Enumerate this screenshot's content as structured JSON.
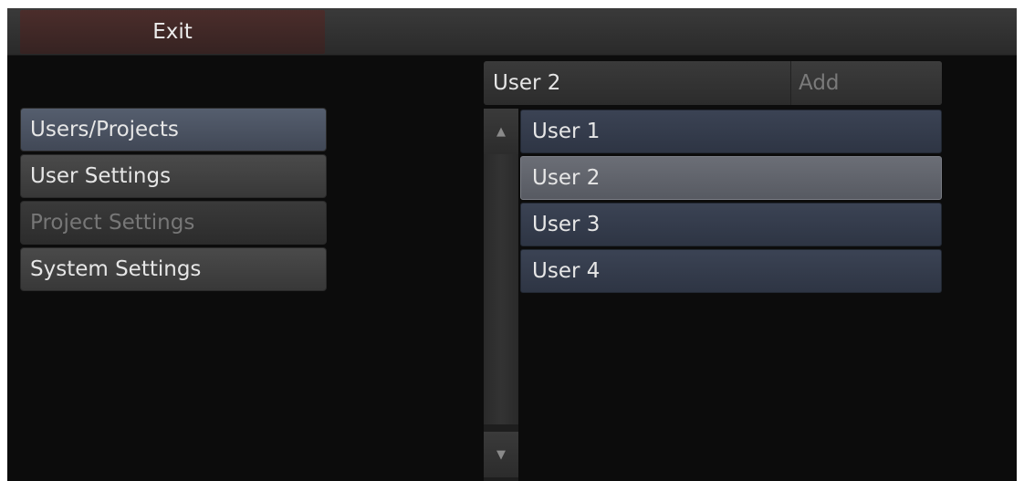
{
  "topbar": {
    "exit_label": "Exit"
  },
  "menu": {
    "items": [
      {
        "label": "Users/Projects",
        "state": "active"
      },
      {
        "label": "User Settings",
        "state": "normal"
      },
      {
        "label": "Project Settings",
        "state": "disabled"
      },
      {
        "label": "System Settings",
        "state": "normal"
      }
    ]
  },
  "user_panel": {
    "input_value": "User 2",
    "add_label": "Add",
    "users": [
      {
        "label": "User 1",
        "selected": false
      },
      {
        "label": "User 2",
        "selected": true
      },
      {
        "label": "User 3",
        "selected": false
      },
      {
        "label": "User 4",
        "selected": false
      }
    ]
  },
  "scrollbar": {
    "up_icon": "▲",
    "down_icon": "▼"
  },
  "colors": {
    "background": "#0c0c0c",
    "exit_button": "#4b2d2b",
    "menu_active": "#555e6e",
    "list_item": "#3b4354",
    "list_selected": "#6b6e76"
  }
}
